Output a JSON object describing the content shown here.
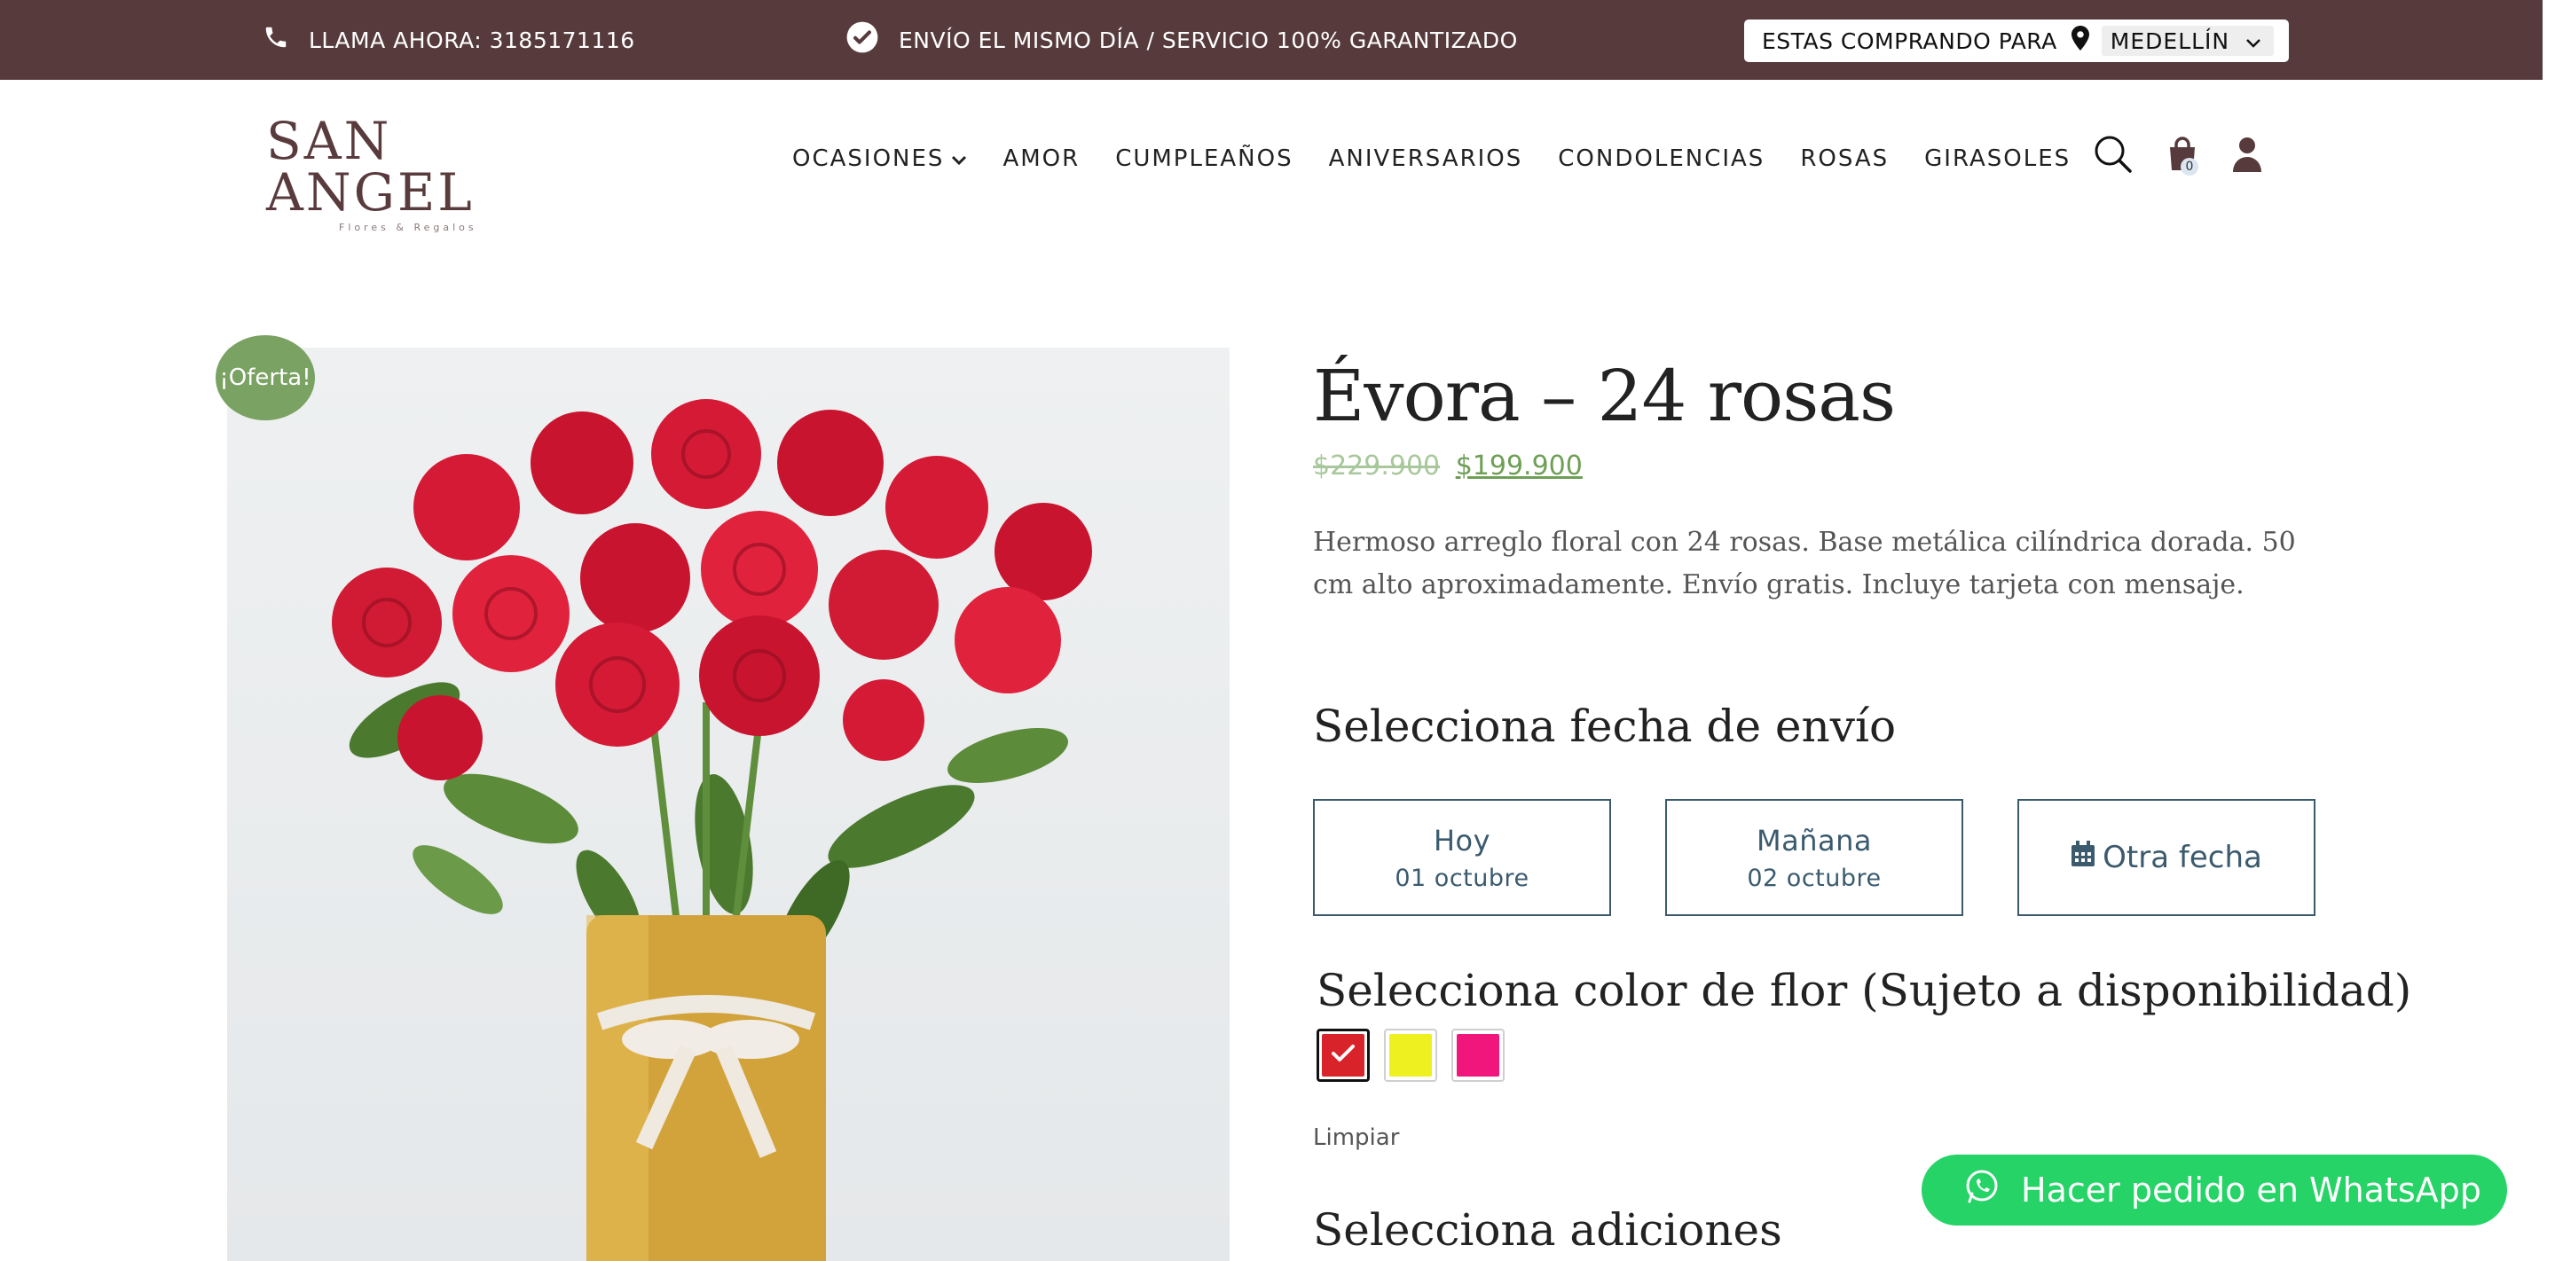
{
  "topbar": {
    "phone_label": "LLAMA AHORA: 3185171116",
    "shipping_label": "ENVÍO EL MISMO DÍA / SERVICIO 100% GARANTIZADO",
    "buying_for_label": "ESTAS COMPRANDO PARA",
    "city": "MEDELLÍN",
    "bg_color": "#573b3c"
  },
  "header": {
    "logo_name": "SAN ANGEL",
    "logo_sub": "Flores & Regalos",
    "nav": [
      {
        "label": "OCASIONES"
      },
      {
        "label": "AMOR"
      },
      {
        "label": "CUMPLEAÑOS"
      },
      {
        "label": "ANIVERSARIOS"
      },
      {
        "label": "CONDOLENCIAS"
      },
      {
        "label": "ROSAS"
      },
      {
        "label": "GIRASOLES"
      }
    ],
    "cart_count": "0",
    "icons": [
      "search-icon",
      "cart-icon",
      "user-icon"
    ]
  },
  "product": {
    "badge": "¡Oferta!",
    "title": "Évora – 24 rosas",
    "old_price": "$229.900",
    "new_price": "$199.900",
    "description": "Hermoso arreglo floral con 24 rosas. Base metálica cilíndrica dorada. 50 cm alto aproximadamente. Envío gratis. Incluye tarjeta con mensaje."
  },
  "delivery": {
    "heading": "Selecciona fecha de envío",
    "options": [
      {
        "label": "Hoy",
        "date": "01 octubre"
      },
      {
        "label": "Mañana",
        "date": "02 octubre"
      },
      {
        "label": "Otra fecha"
      }
    ]
  },
  "color": {
    "heading": "Selecciona color de flor (Sujeto a disponibilidad)",
    "swatches": [
      {
        "name": "rojo",
        "hex": "#d9232a",
        "selected": true
      },
      {
        "name": "amarillo",
        "hex": "#eef01f",
        "selected": false
      },
      {
        "name": "fucsia",
        "hex": "#f0167c",
        "selected": false
      }
    ],
    "clear_label": "Limpiar"
  },
  "additions": {
    "heading": "Selecciona adiciones"
  },
  "whatsapp": {
    "label": "Hacer pedido en WhatsApp",
    "color": "#25d366"
  },
  "colors": {
    "accent_green": "#7aa262",
    "date_border": "#3b5a6e"
  }
}
